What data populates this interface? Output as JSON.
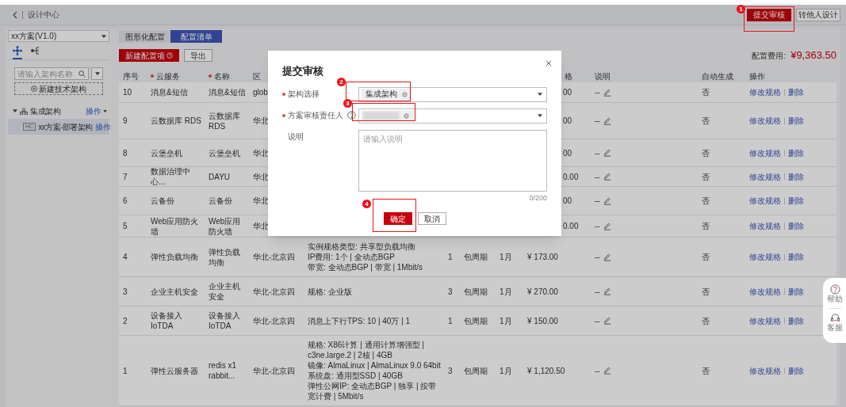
{
  "header": {
    "title": "设计中心",
    "buttons": [
      {
        "label": "提交审核",
        "kind": "primary"
      },
      {
        "label": "转他人设计",
        "kind": "default"
      }
    ]
  },
  "sidebar": {
    "scheme": "xx方案(V1.0)",
    "view_tabs": [
      {
        "selected": true
      },
      {
        "selected": false
      }
    ],
    "search": {
      "placeholder": "请输入架构名称"
    },
    "new_button": "新建技术架构",
    "tree": [
      {
        "label": "集成架构",
        "action": "操作",
        "expanded": true,
        "selected": false,
        "children": [
          {
            "label": "xx方案-部署架构",
            "badge": "HC",
            "action": "操作",
            "selected": true
          }
        ]
      }
    ]
  },
  "main": {
    "tabs": [
      {
        "label": "图形化配置",
        "selected": false
      },
      {
        "label": "配置清单",
        "selected": true
      }
    ],
    "toolbar": [
      {
        "label": "新建配置项",
        "kind": "primary"
      },
      {
        "label": "导出",
        "kind": "default"
      }
    ],
    "total": {
      "label": "配置费用:",
      "value": "¥9,363.50"
    },
    "table": {
      "columns": [
        {
          "label": "序号",
          "required": false
        },
        {
          "label": "云服务",
          "required": true
        },
        {
          "label": "名称",
          "required": true
        },
        {
          "label": "区",
          "required": false
        },
        {
          "label": "格",
          "required": false
        },
        {
          "label": "说明",
          "required": false
        },
        {
          "label": "自动生成",
          "required": false
        },
        {
          "label": "操作",
          "required": false
        }
      ],
      "rows": [
        {
          "seq": "10",
          "service": "消息&短信",
          "name": "消息&短信",
          "region": "glob",
          "price": "00",
          "note": "--",
          "auto": "否",
          "actions": [
            "修改规格",
            "删除"
          ]
        },
        {
          "seq": "9",
          "service": "云数据库 RDS",
          "name": "云数据库 RDS",
          "region": "华北",
          "price": "00",
          "note": "--",
          "auto": "否",
          "actions": [
            "修改规格",
            "删除"
          ]
        },
        {
          "seq": "8",
          "service": "云堡垒机",
          "name": "云堡垒机",
          "region": "华北",
          "price": "00",
          "note": "--",
          "auto": "否",
          "actions": [
            "修改规格",
            "删除"
          ]
        },
        {
          "seq": "7",
          "service": "数据治理中心...",
          "name": "DAYU",
          "region": "华北",
          "price": "0.00",
          "note": "--",
          "auto": "否",
          "actions": [
            "修改规格",
            "删除"
          ]
        },
        {
          "seq": "6",
          "service": "云备份",
          "name": "云备份",
          "region": "华北",
          "price": "00",
          "note": "--",
          "auto": "否",
          "actions": [
            "修改规格",
            "删除"
          ]
        },
        {
          "seq": "5",
          "service": "Web应用防火墙",
          "name": "Web应用防火墙",
          "region": "华北",
          "price": "0.00",
          "note": "--",
          "auto": "否",
          "actions": [
            "修改规格",
            "删除"
          ]
        },
        {
          "seq": "4",
          "service": "弹性负载均衡",
          "name": "弹性负载均衡",
          "region": "华北-北京四",
          "spec": [
            "实例规格类型: 共享型负载均衡",
            "IP费用: 1个 | 全动态BGP",
            "带宽: 全动态BGP | 带宽 | 1Mbit/s"
          ],
          "quantity": "1",
          "billing": "包周期",
          "duration": "1月",
          "price": "¥ 173.00",
          "note": "--",
          "auto": "否",
          "actions": [
            "修改规格",
            "删除"
          ]
        },
        {
          "seq": "3",
          "service": "企业主机安全",
          "name": "企业主机安全",
          "region": "华北-北京四",
          "spec": [
            "规格: 企业版"
          ],
          "quantity": "3",
          "billing": "包周期",
          "duration": "1月",
          "price": "¥ 270.00",
          "note": "--",
          "auto": "否",
          "actions": [
            "修改规格",
            "删除"
          ]
        },
        {
          "seq": "2",
          "service": "设备接入IoTDA",
          "name": "设备接入IoTDA",
          "region": "华北-北京四",
          "spec": [
            "消息上下行TPS: 10 | 40万 | 1"
          ],
          "quantity": "1",
          "billing": "包周期",
          "duration": "1月",
          "price": "¥ 150.00",
          "note": "--",
          "auto": "否",
          "actions": [
            "修改规格",
            "删除"
          ]
        },
        {
          "seq": "1",
          "service": "弹性云服务器",
          "name": "redis x1 rabbit...",
          "region": "华北-北京四",
          "spec": [
            "规格: X86计算 | 通用计算增强型 | c3ne.large.2 | 2核 | 4GB",
            "镜像: AlmaLinux | AlmaLinux 9.0 64bit",
            "系统盘: 通用型SSD | 40GB",
            "弹性公网IP: 全动态BGP | 独享 | 按带宽计费 | 5Mbit/s"
          ],
          "quantity": "3",
          "billing": "包周期",
          "duration": "1月",
          "price": "¥ 1,120.50",
          "note": "--",
          "auto": "否",
          "actions": [
            "修改规格",
            "删除"
          ]
        }
      ]
    }
  },
  "dialog": {
    "title": "提交审核",
    "fields": [
      {
        "kind": "select",
        "label": "架构选择",
        "required": true,
        "help": false,
        "tag": "集成架构"
      },
      {
        "kind": "select",
        "label": "方案审核责任人",
        "required": true,
        "help": true,
        "redacted": true
      },
      {
        "kind": "textarea",
        "label": "说明",
        "required": false,
        "help": false,
        "placeholder": "请输入说明",
        "counter": "0/200"
      }
    ],
    "buttons": [
      {
        "label": "确定",
        "kind": "primary"
      },
      {
        "label": "取消",
        "kind": "default"
      }
    ]
  },
  "annotations": [
    {
      "number": "1"
    },
    {
      "number": "2"
    },
    {
      "number": "3"
    },
    {
      "number": "4"
    }
  ],
  "float_help": [
    {
      "label": "帮助"
    },
    {
      "label": "客服"
    }
  ]
}
